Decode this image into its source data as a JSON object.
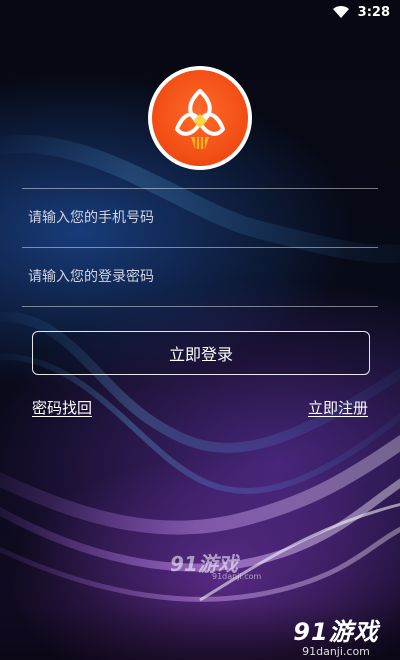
{
  "status_bar": {
    "time": "3:28"
  },
  "form": {
    "phone_placeholder": "请输入您的手机号码",
    "password_placeholder": "请输入您的登录密码",
    "login_label": "立即登录",
    "forgot_password": "密码找回",
    "register": "立即注册"
  },
  "watermark": {
    "center_main": "91游戏",
    "center_url": "91danji.com",
    "corner_main": "91游戏",
    "corner_url": "91danji.com"
  },
  "colors": {
    "logo_orange": "#f04b12",
    "background": "#05060e"
  }
}
